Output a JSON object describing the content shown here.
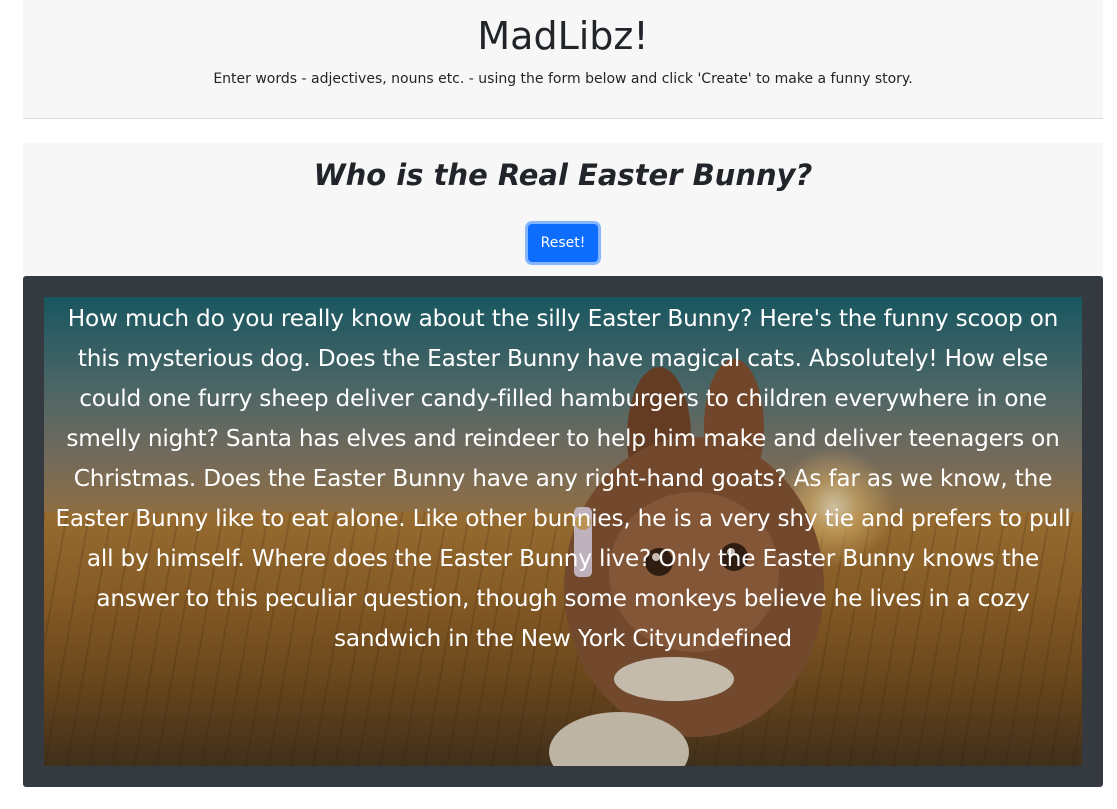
{
  "header": {
    "title": "MadLibz!",
    "subtitle": "Enter words - adjectives, nouns etc. - using the form below and click 'Create' to make a funny story."
  },
  "story": {
    "title": "Who is the Real Easter Bunny?",
    "reset_label": "Reset!",
    "text": "How much do you really know about the silly Easter Bunny? Here's the funny scoop on this mysterious dog. Does the Easter Bunny have magical cats. Absolutely! How else could one furry sheep deliver candy-filled hamburgers to children everywhere in one smelly night? Santa has elves and reindeer to help him make and deliver teenagers on Christmas. Does the Easter Bunny have any right-hand goats? As far as we know, the Easter Bunny like to eat alone. Like other bunnies, he is a very shy tie and prefers to pull all by himself. Where does the Easter Bunny live? Only the Easter Bunny knows the answer to this peculiar question, though some monkeys believe he lives in a cozy sandwich in the New York Cityundefined"
  },
  "colors": {
    "accent": "#0d6efd",
    "panel": "#343a40",
    "header_bg": "#f7f7f7"
  }
}
